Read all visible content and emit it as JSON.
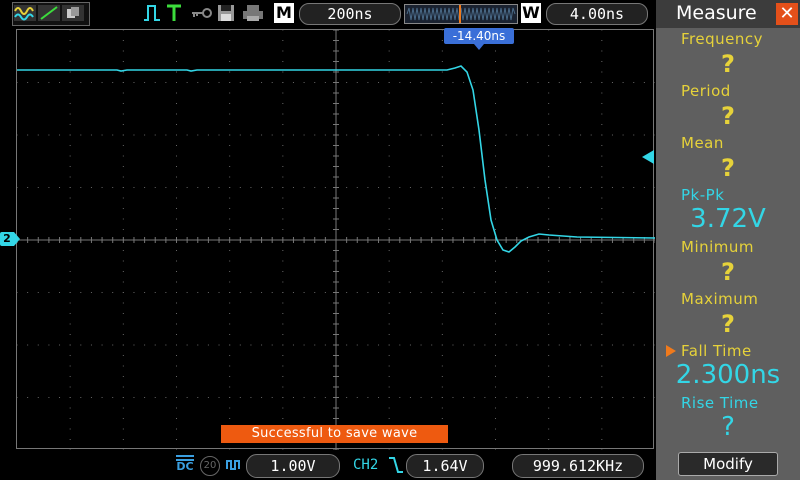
{
  "colors": {
    "trace": "#33d6e6",
    "accent": "#e6d23a",
    "toast": "#ee5a10",
    "trigger_marker": "#3a6fd8",
    "close": "#e4501a"
  },
  "topbar": {
    "icons": [
      "autoset-waveform-icon",
      "cursor-icon",
      "persist-icon",
      "trigger-pulse-icon",
      "trigger-T-icon",
      "key-lock-icon",
      "save-disk-icon",
      "print-icon"
    ],
    "timebase_mode_letter": "M",
    "timebase": "200ns",
    "window_letter": "W",
    "window_time": "4.00ns"
  },
  "screen": {
    "trigger_position": "-14.40ns",
    "channel_marker": "2",
    "toast": "Successful to save wave"
  },
  "bottombar": {
    "ch1_coupling": "DC",
    "ch1_bw_limit": "20",
    "ch1_scale": "1.00V",
    "trigger_source": "CH2",
    "trigger_level": "1.64V",
    "frequency": "999.612KHz"
  },
  "measure": {
    "title": "Measure",
    "items": [
      {
        "label": "Frequency",
        "value": "?"
      },
      {
        "label": "Period",
        "value": "?"
      },
      {
        "label": "Mean",
        "value": "?"
      },
      {
        "label": "Pk-Pk",
        "value": "3.72V"
      },
      {
        "label": "Minimum",
        "value": "?"
      },
      {
        "label": "Maximum",
        "value": "?"
      },
      {
        "label": "Fall Time",
        "value": "2.300ns"
      },
      {
        "label": "Rise Time",
        "value": "?"
      }
    ],
    "modify_label": "Modify"
  }
}
